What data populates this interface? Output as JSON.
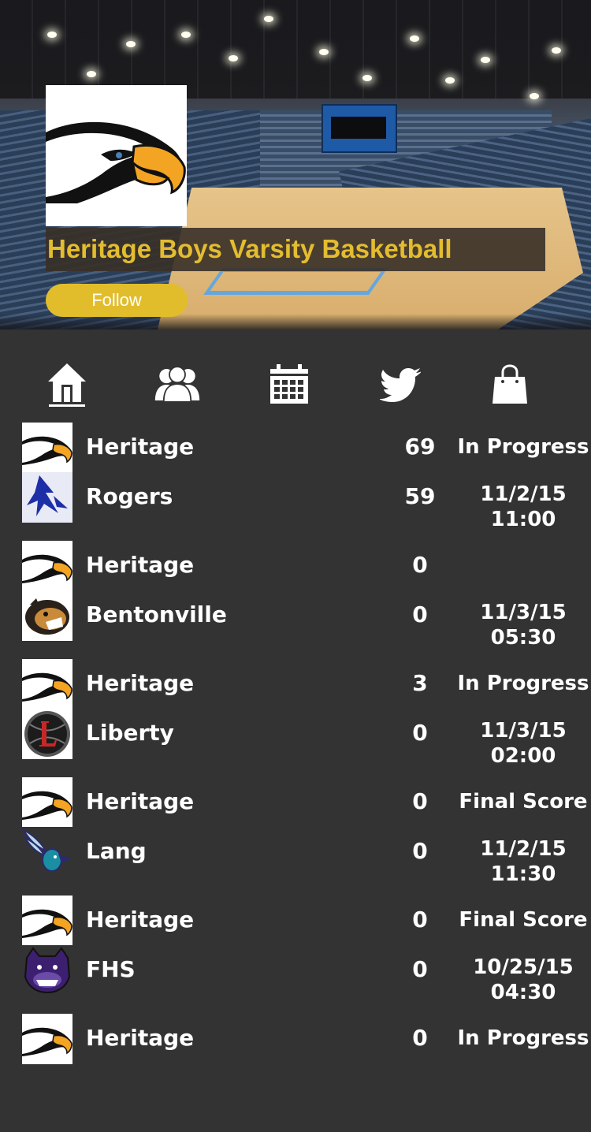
{
  "header": {
    "team_title": "Heritage Boys Varsity Basketball",
    "follow_label": "Follow",
    "logo_icon": "eagle-logo-icon"
  },
  "nav": {
    "items": [
      {
        "icon": "home-icon"
      },
      {
        "icon": "roster-icon"
      },
      {
        "icon": "calendar-icon"
      },
      {
        "icon": "twitter-icon"
      },
      {
        "icon": "shop-bag-icon"
      }
    ]
  },
  "colors": {
    "accent_gold": "#e2bd2b",
    "background": "#333333",
    "title_band": "#383028"
  },
  "games": [
    {
      "home": {
        "name": "Heritage",
        "score": "69",
        "logo": "eagle"
      },
      "away": {
        "name": "Rogers",
        "score": "59",
        "logo": "rogers-mountie"
      },
      "status": "In Progress",
      "date": "11/2/15",
      "time": "11:00"
    },
    {
      "home": {
        "name": "Heritage",
        "score": "0",
        "logo": "eagle"
      },
      "away": {
        "name": "Bentonville",
        "score": "0",
        "logo": "tiger"
      },
      "status": "",
      "date": "11/3/15",
      "time": "05:30"
    },
    {
      "home": {
        "name": "Heritage",
        "score": "3",
        "logo": "eagle"
      },
      "away": {
        "name": "Liberty",
        "score": "0",
        "logo": "liberty-l"
      },
      "status": "In Progress",
      "date": "11/3/15",
      "time": "02:00"
    },
    {
      "home": {
        "name": "Heritage",
        "score": "0",
        "logo": "eagle"
      },
      "away": {
        "name": "Lang",
        "score": "0",
        "logo": "hornet"
      },
      "status": "Final Score",
      "date": "11/2/15",
      "time": "11:30"
    },
    {
      "home": {
        "name": "Heritage",
        "score": "0",
        "logo": "eagle"
      },
      "away": {
        "name": "FHS",
        "score": "0",
        "logo": "bulldog"
      },
      "status": "Final Score",
      "date": "10/25/15",
      "time": "04:30"
    },
    {
      "home": {
        "name": "Heritage",
        "score": "0",
        "logo": "eagle"
      },
      "away": {
        "name": "",
        "score": "",
        "logo": ""
      },
      "status": "In Progress",
      "date": "",
      "time": ""
    }
  ]
}
